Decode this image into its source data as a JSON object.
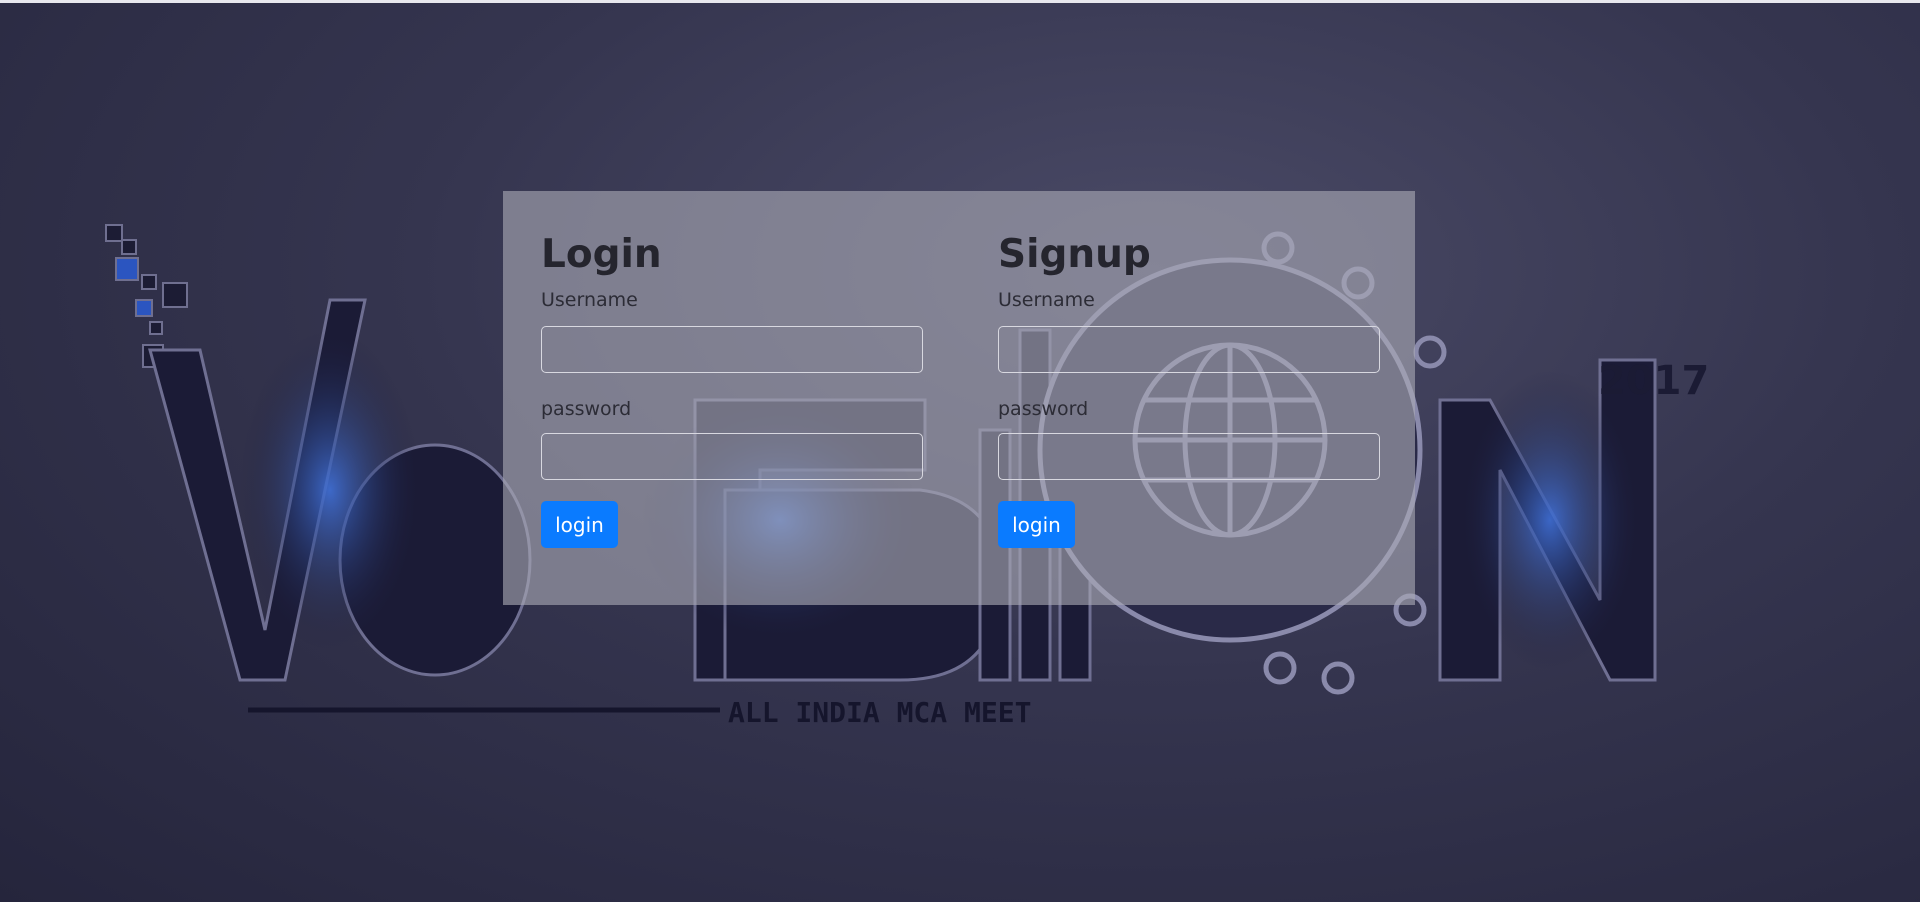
{
  "background": {
    "logo_text": "VERSION",
    "logo_tagline": "ALL INDIA MCA MEET",
    "logo_year": "2017"
  },
  "login": {
    "title": "Login",
    "username_label": "Username",
    "username_value": "",
    "password_label": "password",
    "password_value": "",
    "button_label": "login"
  },
  "signup": {
    "title": "Signup",
    "username_label": "Username",
    "username_value": "",
    "password_label": "password",
    "password_value": "",
    "button_label": "login"
  },
  "colors": {
    "accent": "#0a7bff",
    "panel": "#aaaab4"
  }
}
